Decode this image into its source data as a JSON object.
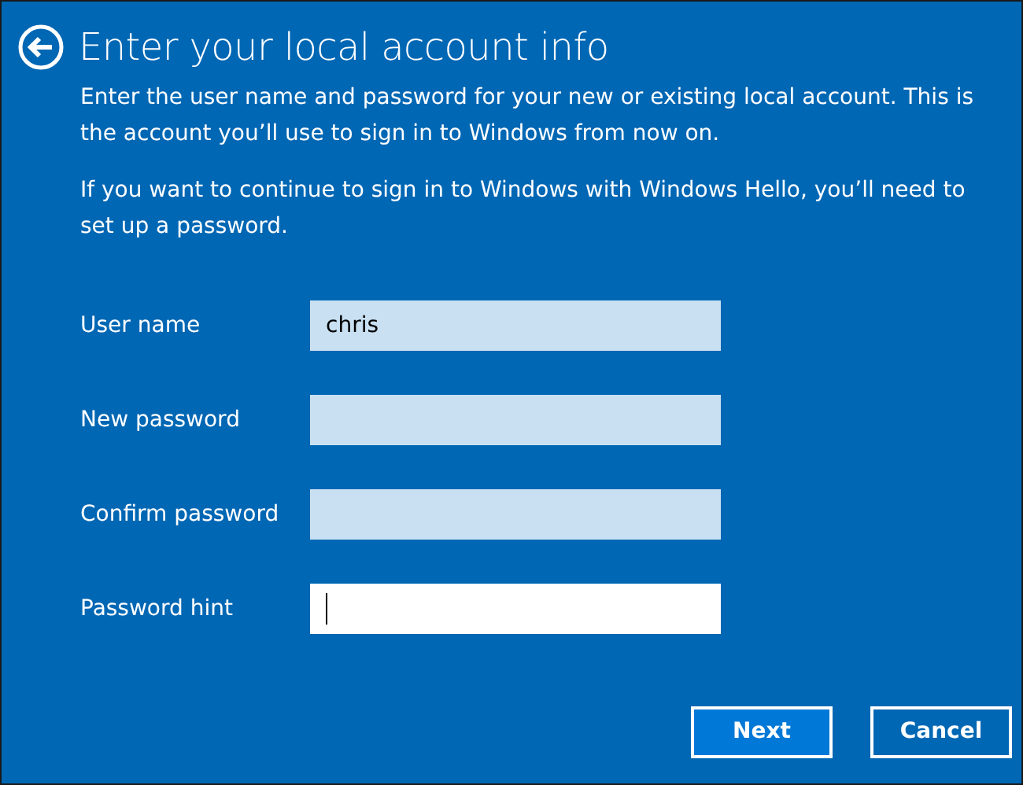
{
  "title": "Enter your local account info",
  "paragraphs": [
    "Enter the user name and password for your new or existing local account. This is the account you’ll use to sign in to Windows from now on.",
    "If you want to continue to sign in to Windows with Windows Hello, you’ll need to set up a password."
  ],
  "fields": [
    {
      "label": "User name",
      "value": "chris",
      "focused": false
    },
    {
      "label": "New password",
      "focused": false
    },
    {
      "label": "Confirm password",
      "focused": false
    },
    {
      "label": "Password hint",
      "focused": true
    }
  ],
  "buttons": [
    {
      "label": "Next",
      "primary": true
    },
    {
      "label": "Cancel",
      "primary": false
    }
  ]
}
